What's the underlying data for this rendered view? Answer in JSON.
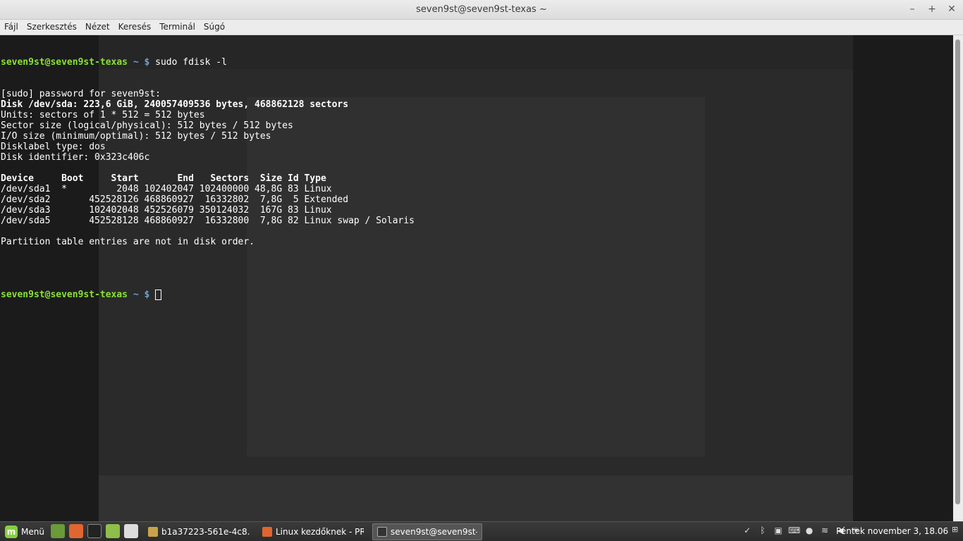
{
  "window": {
    "title": "seven9st@seven9st-texas ~"
  },
  "menu": {
    "items": [
      "Fájl",
      "Szerkesztés",
      "Nézet",
      "Keresés",
      "Terminál",
      "Súgó"
    ]
  },
  "terminal": {
    "prompt1": {
      "userhost": "seven9st@seven9st-texas",
      "dir": " ~ $",
      "command": " sudo fdisk -l"
    },
    "lines": [
      {
        "text": "[sudo] password for seven9st:",
        "bold": false
      },
      {
        "text": "Disk /dev/sda: 223,6 GiB, 240057409536 bytes, 468862128 sectors",
        "bold": true
      },
      {
        "text": "Units: sectors of 1 * 512 = 512 bytes",
        "bold": false
      },
      {
        "text": "Sector size (logical/physical): 512 bytes / 512 bytes",
        "bold": false
      },
      {
        "text": "I/O size (minimum/optimal): 512 bytes / 512 bytes",
        "bold": false
      },
      {
        "text": "Disklabel type: dos",
        "bold": false
      },
      {
        "text": "Disk identifier: 0x323c406c",
        "bold": false
      },
      {
        "text": "",
        "bold": false
      },
      {
        "text": "Device     Boot     Start       End   Sectors  Size Id Type",
        "bold": true
      },
      {
        "text": "/dev/sda1  *         2048 102402047 102400000 48,8G 83 Linux",
        "bold": false
      },
      {
        "text": "/dev/sda2       452528126 468860927  16332802  7,8G  5 Extended",
        "bold": false
      },
      {
        "text": "/dev/sda3       102402048 452526079 350124032  167G 83 Linux",
        "bold": false
      },
      {
        "text": "/dev/sda5       452528128 468860927  16332800  7,8G 82 Linux swap / Solaris",
        "bold": false
      },
      {
        "text": "",
        "bold": false
      },
      {
        "text": "Partition table entries are not in disk order.",
        "bold": false
      },
      {
        "text": "",
        "bold": false
      },
      {
        "text": "",
        "bold": false
      }
    ],
    "prompt2": {
      "userhost": "seven9st@seven9st-texas",
      "dir": " ~ $",
      "command": " "
    }
  },
  "taskbar": {
    "menu_label": "Menü",
    "tasks": [
      {
        "label": "b1a37223-561e-4c8...",
        "icon_color": "#c9a24a"
      },
      {
        "label": "Linux kezdőknek - PR...",
        "icon_color": "#e0662f"
      },
      {
        "label": "seven9st@seven9st-...",
        "icon_color": "#333333"
      }
    ],
    "clock": "Péntek november  3, 18.06"
  },
  "colors": {
    "prompt": "#8ae234",
    "path": "#729fcf",
    "terminal_bg": "#1b1b1b",
    "mint": "#87cf3e"
  }
}
